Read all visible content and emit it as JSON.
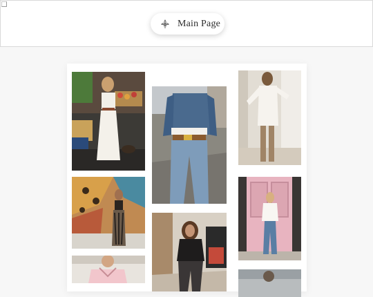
{
  "header": {
    "button_label": "Main Page",
    "button_icon": "fleur-de-lis-icon"
  },
  "gallery": {
    "photos": [
      {
        "subject": "market-stall-outfit"
      },
      {
        "subject": "denim-jacket-outfit"
      },
      {
        "subject": "white-sweater-dress-outfit"
      },
      {
        "subject": "mural-wall-outfit"
      },
      {
        "subject": "pink-door-outfit"
      },
      {
        "subject": "dark-jacket-outfit"
      },
      {
        "subject": "pink-top-outfit"
      },
      {
        "subject": "grey-outfit"
      }
    ]
  },
  "colors": {
    "header_bg": "#ffffff",
    "page_bg": "#f7f7f7",
    "text": "#2d2d2d"
  }
}
